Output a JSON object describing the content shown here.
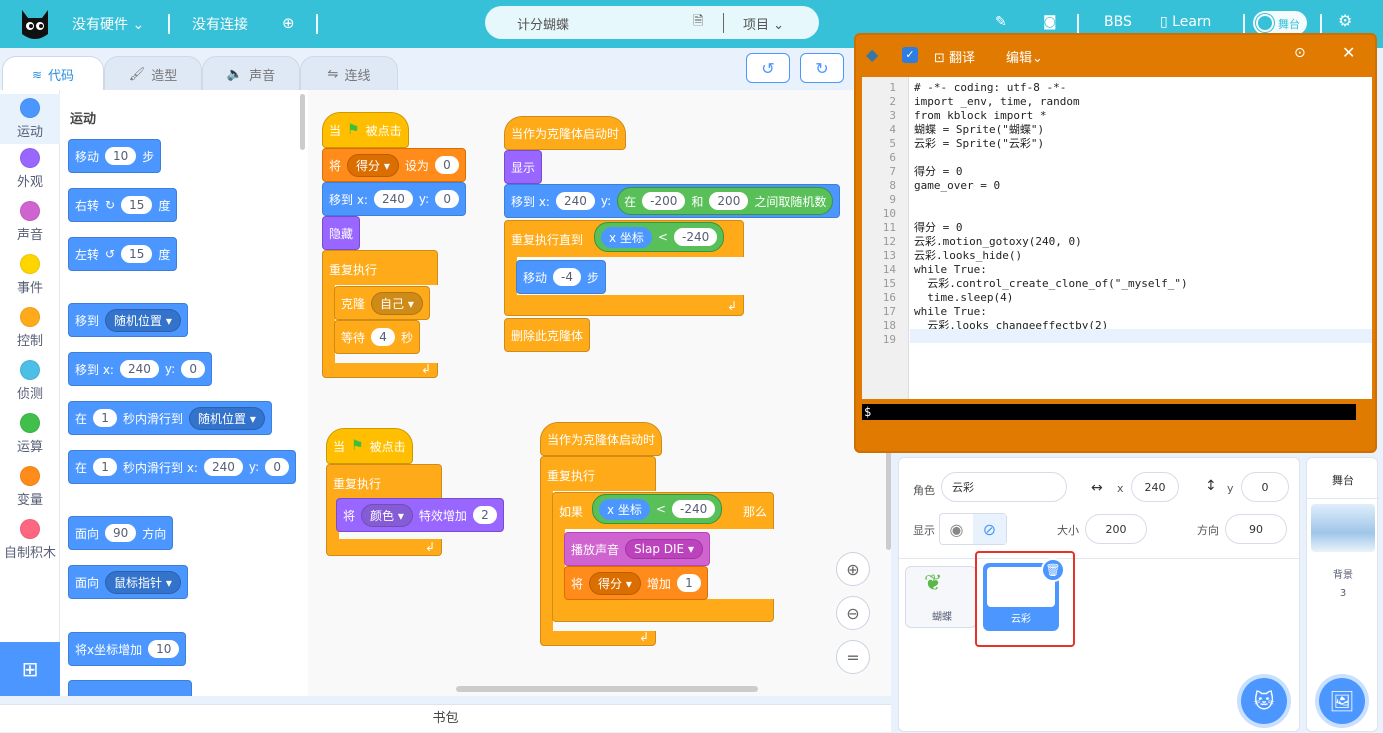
{
  "topbar": {
    "hardware": "没有硬件",
    "connection": "没有连接",
    "project_name": "计分蝴蝶",
    "project_menu": "项目",
    "bbs": "BBS",
    "learn": "Learn",
    "stage_toggle": "舞台"
  },
  "tabs": {
    "code": "代码",
    "costumes": "造型",
    "sounds": "声音",
    "connect": "连线"
  },
  "categories": [
    {
      "label": "运动",
      "color": "#4c97ff"
    },
    {
      "label": "外观",
      "color": "#9966ff"
    },
    {
      "label": "声音",
      "color": "#cf63cf"
    },
    {
      "label": "事件",
      "color": "#ffd500"
    },
    {
      "label": "控制",
      "color": "#ffab19"
    },
    {
      "label": "侦测",
      "color": "#4cbfe6"
    },
    {
      "label": "运算",
      "color": "#40bf4a"
    },
    {
      "label": "变量",
      "color": "#ff8c1a"
    },
    {
      "label": "自制积木",
      "color": "#ff6680"
    }
  ],
  "palette": {
    "heading": "运动",
    "move": {
      "pre": "移动",
      "val": "10",
      "post": "步"
    },
    "turn_right": {
      "pre": "右转",
      "val": "15",
      "post": "度"
    },
    "turn_left": {
      "pre": "左转",
      "val": "15",
      "post": "度"
    },
    "goto": {
      "pre": "移到",
      "dd": "随机位置"
    },
    "gotoxy": {
      "pre": "移到 x:",
      "x": "240",
      "y_lbl": "y:",
      "y": "0"
    },
    "glide": {
      "pre": "在",
      "val": "1",
      "mid": "秒内滑行到",
      "dd": "随机位置"
    },
    "glidexy": {
      "pre": "在",
      "val": "1",
      "mid": "秒内滑行到 x:",
      "x": "240",
      "y_lbl": "y:",
      "y": "0"
    },
    "point": {
      "pre": "面向",
      "val": "90",
      "post": "方向"
    },
    "pointto": {
      "pre": "面向",
      "dd": "鼠标指针"
    },
    "changex": {
      "pre": "将x坐标增加",
      "val": "10"
    }
  },
  "scripts": {
    "s1": {
      "hat_pre": "当",
      "hat_post": "被点击",
      "set_pre": "将",
      "set_var": "得分",
      "set_mid": "设为",
      "set_val": "0",
      "goto_pre": "移到 x:",
      "goto_x": "240",
      "goto_ylbl": "y:",
      "goto_y": "0",
      "hide": "隐藏",
      "forever": "重复执行",
      "clone": "克隆",
      "clone_dd": "自己",
      "wait": "等待",
      "wait_val": "4",
      "wait_post": "秒"
    },
    "s2": {
      "hat": "当作为克隆体启动时",
      "show": "显示",
      "goto_pre": "移到 x:",
      "goto_x": "240",
      "goto_ylbl": "y:",
      "rand_pre": "在",
      "rand_a": "-200",
      "rand_mid": "和",
      "rand_b": "200",
      "rand_post": "之间取随机数",
      "repeat": "重复执行直到",
      "cond_lbl": "x 坐标",
      "cond_op": "<",
      "cond_val": "-240",
      "move": "移动",
      "move_val": "-4",
      "move_post": "步",
      "delete": "删除此克隆体"
    },
    "s3": {
      "hat_pre": "当",
      "hat_post": "被点击",
      "forever": "重复执行",
      "eff_pre": "将",
      "eff_dd": "颜色",
      "eff_mid": "特效增加",
      "eff_val": "2"
    },
    "s4": {
      "hat": "当作为克隆体启动时",
      "forever": "重复执行",
      "if": "如果",
      "cond_lbl": "x 坐标",
      "cond_op": "<",
      "cond_val": "-240",
      "then": "那么",
      "sound": "播放声音",
      "sound_dd": "Slap DIE",
      "chg_pre": "将",
      "chg_var": "得分",
      "chg_mid": "增加",
      "chg_val": "1"
    }
  },
  "editor": {
    "translate": "翻译",
    "edit": "编辑",
    "prompt": "$",
    "lines": [
      "# -*- coding: utf-8 -*-",
      "import _env, time, random",
      "from kblock import *",
      "蝴蝶 = Sprite(\"蝴蝶\")",
      "云彩 = Sprite(\"云彩\")",
      "",
      "得分 = 0",
      "game_over = 0",
      "",
      "",
      "得分 = 0",
      "云彩.motion_gotoxy(240, 0)",
      "云彩.looks_hide()",
      "while True:",
      "  云彩.control_create_clone_of(\"_myself_\")",
      "  time.sleep(4)",
      "while True:",
      "  云彩.looks_changeeffectby(2)",
      ""
    ],
    "line_numbers": [
      "1",
      "2",
      "3",
      "4",
      "5",
      "6",
      "7",
      "8",
      "9",
      "10",
      "11",
      "12",
      "13",
      "14",
      "15",
      "16",
      "17",
      "18",
      "19"
    ]
  },
  "sprite_info": {
    "sprite_lbl": "角色",
    "sprite_name": "云彩",
    "x_lbl": "x",
    "x": "240",
    "y_lbl": "y",
    "y": "0",
    "show_lbl": "显示",
    "size_lbl": "大小",
    "size": "200",
    "dir_lbl": "方向",
    "dir": "90"
  },
  "sprites": [
    {
      "name": "蝴蝶"
    },
    {
      "name": "云彩"
    }
  ],
  "stage": {
    "title": "舞台",
    "bg_lbl": "背景",
    "bg_count": "3"
  },
  "backpack": "书包"
}
